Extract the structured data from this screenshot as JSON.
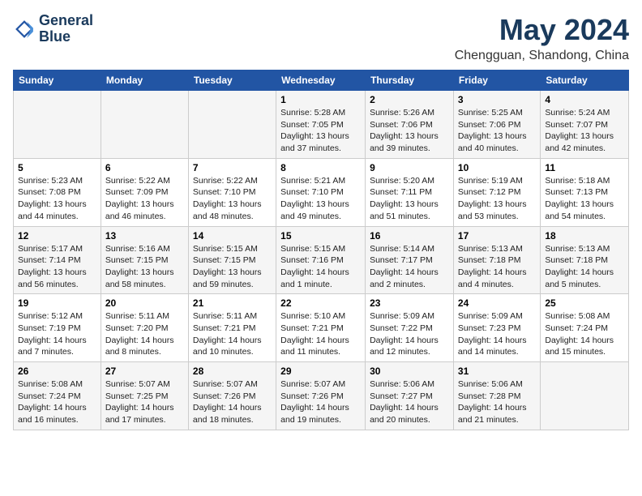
{
  "header": {
    "logo_line1": "General",
    "logo_line2": "Blue",
    "main_title": "May 2024",
    "subtitle": "Chengguan, Shandong, China"
  },
  "days_of_week": [
    "Sunday",
    "Monday",
    "Tuesday",
    "Wednesday",
    "Thursday",
    "Friday",
    "Saturday"
  ],
  "weeks": [
    [
      {
        "day": "",
        "info": ""
      },
      {
        "day": "",
        "info": ""
      },
      {
        "day": "",
        "info": ""
      },
      {
        "day": "1",
        "info": "Sunrise: 5:28 AM\nSunset: 7:05 PM\nDaylight: 13 hours\nand 37 minutes."
      },
      {
        "day": "2",
        "info": "Sunrise: 5:26 AM\nSunset: 7:06 PM\nDaylight: 13 hours\nand 39 minutes."
      },
      {
        "day": "3",
        "info": "Sunrise: 5:25 AM\nSunset: 7:06 PM\nDaylight: 13 hours\nand 40 minutes."
      },
      {
        "day": "4",
        "info": "Sunrise: 5:24 AM\nSunset: 7:07 PM\nDaylight: 13 hours\nand 42 minutes."
      }
    ],
    [
      {
        "day": "5",
        "info": "Sunrise: 5:23 AM\nSunset: 7:08 PM\nDaylight: 13 hours\nand 44 minutes."
      },
      {
        "day": "6",
        "info": "Sunrise: 5:22 AM\nSunset: 7:09 PM\nDaylight: 13 hours\nand 46 minutes."
      },
      {
        "day": "7",
        "info": "Sunrise: 5:22 AM\nSunset: 7:10 PM\nDaylight: 13 hours\nand 48 minutes."
      },
      {
        "day": "8",
        "info": "Sunrise: 5:21 AM\nSunset: 7:10 PM\nDaylight: 13 hours\nand 49 minutes."
      },
      {
        "day": "9",
        "info": "Sunrise: 5:20 AM\nSunset: 7:11 PM\nDaylight: 13 hours\nand 51 minutes."
      },
      {
        "day": "10",
        "info": "Sunrise: 5:19 AM\nSunset: 7:12 PM\nDaylight: 13 hours\nand 53 minutes."
      },
      {
        "day": "11",
        "info": "Sunrise: 5:18 AM\nSunset: 7:13 PM\nDaylight: 13 hours\nand 54 minutes."
      }
    ],
    [
      {
        "day": "12",
        "info": "Sunrise: 5:17 AM\nSunset: 7:14 PM\nDaylight: 13 hours\nand 56 minutes."
      },
      {
        "day": "13",
        "info": "Sunrise: 5:16 AM\nSunset: 7:15 PM\nDaylight: 13 hours\nand 58 minutes."
      },
      {
        "day": "14",
        "info": "Sunrise: 5:15 AM\nSunset: 7:15 PM\nDaylight: 13 hours\nand 59 minutes."
      },
      {
        "day": "15",
        "info": "Sunrise: 5:15 AM\nSunset: 7:16 PM\nDaylight: 14 hours\nand 1 minute."
      },
      {
        "day": "16",
        "info": "Sunrise: 5:14 AM\nSunset: 7:17 PM\nDaylight: 14 hours\nand 2 minutes."
      },
      {
        "day": "17",
        "info": "Sunrise: 5:13 AM\nSunset: 7:18 PM\nDaylight: 14 hours\nand 4 minutes."
      },
      {
        "day": "18",
        "info": "Sunrise: 5:13 AM\nSunset: 7:18 PM\nDaylight: 14 hours\nand 5 minutes."
      }
    ],
    [
      {
        "day": "19",
        "info": "Sunrise: 5:12 AM\nSunset: 7:19 PM\nDaylight: 14 hours\nand 7 minutes."
      },
      {
        "day": "20",
        "info": "Sunrise: 5:11 AM\nSunset: 7:20 PM\nDaylight: 14 hours\nand 8 minutes."
      },
      {
        "day": "21",
        "info": "Sunrise: 5:11 AM\nSunset: 7:21 PM\nDaylight: 14 hours\nand 10 minutes."
      },
      {
        "day": "22",
        "info": "Sunrise: 5:10 AM\nSunset: 7:21 PM\nDaylight: 14 hours\nand 11 minutes."
      },
      {
        "day": "23",
        "info": "Sunrise: 5:09 AM\nSunset: 7:22 PM\nDaylight: 14 hours\nand 12 minutes."
      },
      {
        "day": "24",
        "info": "Sunrise: 5:09 AM\nSunset: 7:23 PM\nDaylight: 14 hours\nand 14 minutes."
      },
      {
        "day": "25",
        "info": "Sunrise: 5:08 AM\nSunset: 7:24 PM\nDaylight: 14 hours\nand 15 minutes."
      }
    ],
    [
      {
        "day": "26",
        "info": "Sunrise: 5:08 AM\nSunset: 7:24 PM\nDaylight: 14 hours\nand 16 minutes."
      },
      {
        "day": "27",
        "info": "Sunrise: 5:07 AM\nSunset: 7:25 PM\nDaylight: 14 hours\nand 17 minutes."
      },
      {
        "day": "28",
        "info": "Sunrise: 5:07 AM\nSunset: 7:26 PM\nDaylight: 14 hours\nand 18 minutes."
      },
      {
        "day": "29",
        "info": "Sunrise: 5:07 AM\nSunset: 7:26 PM\nDaylight: 14 hours\nand 19 minutes."
      },
      {
        "day": "30",
        "info": "Sunrise: 5:06 AM\nSunset: 7:27 PM\nDaylight: 14 hours\nand 20 minutes."
      },
      {
        "day": "31",
        "info": "Sunrise: 5:06 AM\nSunset: 7:28 PM\nDaylight: 14 hours\nand 21 minutes."
      },
      {
        "day": "",
        "info": ""
      }
    ]
  ]
}
